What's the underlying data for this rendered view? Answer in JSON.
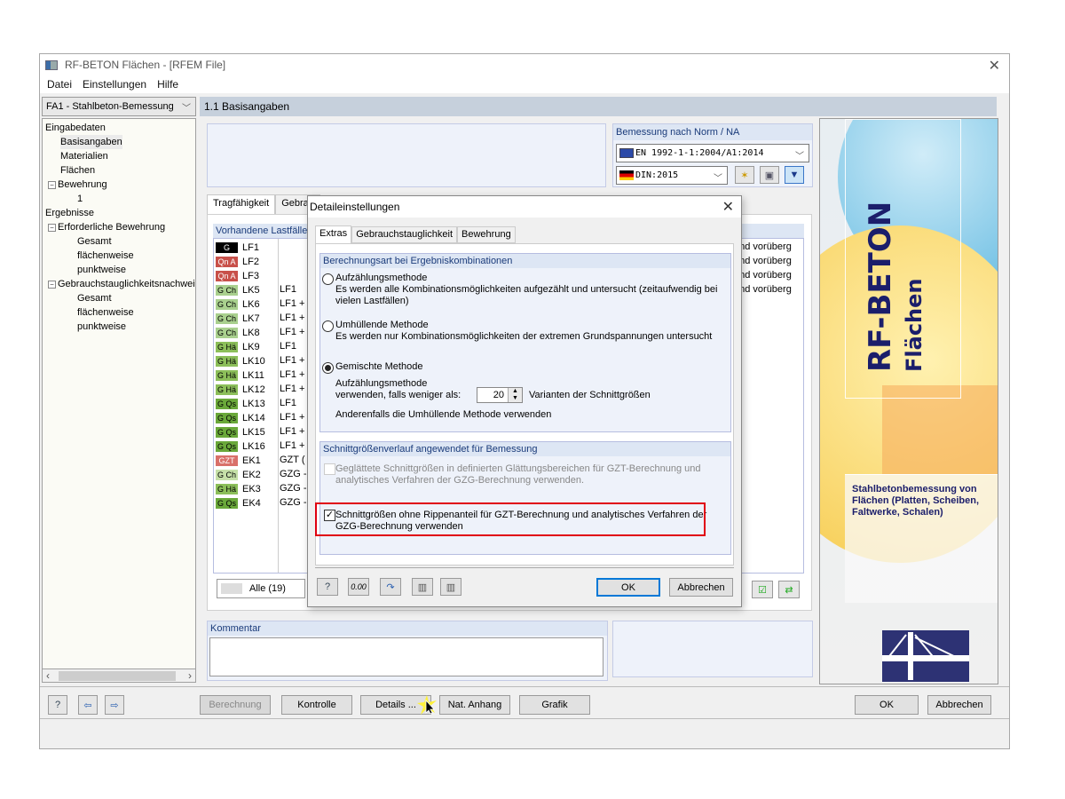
{
  "window": {
    "title": "RF-BETON Flächen - [RFEM File]",
    "menu": [
      "Datei",
      "Einstellungen",
      "Hilfe"
    ]
  },
  "nav": {
    "case_selector": "FA1 - Stahlbeton-Bemessung",
    "tree": [
      {
        "label": "Eingabedaten",
        "level": 0
      },
      {
        "label": "Basisangaben",
        "level": 1,
        "selected": true
      },
      {
        "label": "Materialien",
        "level": 1
      },
      {
        "label": "Flächen",
        "level": 1
      },
      {
        "label": "Bewehrung",
        "level": 1,
        "expander": "−"
      },
      {
        "label": "1",
        "level": 2
      },
      {
        "label": "Ergebnisse",
        "level": 0
      },
      {
        "label": "Erforderliche Bewehrung",
        "level": 1,
        "expander": "−"
      },
      {
        "label": "Gesamt",
        "level": 2
      },
      {
        "label": "flächenweise",
        "level": 2
      },
      {
        "label": "punktweise",
        "level": 2
      },
      {
        "label": "Gebrauchstauglichkeitsnachwei",
        "level": 1,
        "expander": "−"
      },
      {
        "label": "Gesamt",
        "level": 2
      },
      {
        "label": "flächenweise",
        "level": 2
      },
      {
        "label": "punktweise",
        "level": 2
      }
    ]
  },
  "main": {
    "section_title": "1.1 Basisangaben",
    "norm": {
      "header": "Bemessung nach Norm / NA",
      "standard": "EN 1992-1-1:2004/A1:2014",
      "national_annex": "DIN:2015"
    },
    "tabs": [
      "Tragfähigkeit",
      "Gebrau"
    ],
    "loads_header": "Vorhandene Lastfälle",
    "loads": [
      {
        "badge": "G",
        "name": "LF1",
        "desc": "",
        "badge_bg": "#000000",
        "badge_fg": "#ffffff"
      },
      {
        "badge": "Qn A",
        "name": "LF2",
        "desc": "",
        "badge_bg": "#c8504a",
        "badge_fg": "#ffffff"
      },
      {
        "badge": "Qn A",
        "name": "LF3",
        "desc": "",
        "badge_bg": "#c8504a",
        "badge_fg": "#ffffff"
      },
      {
        "badge": "G Ch",
        "name": "LK5",
        "desc": "LF1",
        "badge_bg": "#a9d08e",
        "badge_fg": "#000000"
      },
      {
        "badge": "G Ch",
        "name": "LK6",
        "desc": "LF1 +",
        "badge_bg": "#a9d08e",
        "badge_fg": "#000000"
      },
      {
        "badge": "G Ch",
        "name": "LK7",
        "desc": "LF1 +",
        "badge_bg": "#a9d08e",
        "badge_fg": "#000000"
      },
      {
        "badge": "G Ch",
        "name": "LK8",
        "desc": "LF1 +",
        "badge_bg": "#a9d08e",
        "badge_fg": "#000000"
      },
      {
        "badge": "G Hä",
        "name": "LK9",
        "desc": "LF1",
        "badge_bg": "#8cbf5a",
        "badge_fg": "#000000"
      },
      {
        "badge": "G Hä",
        "name": "LK10",
        "desc": "LF1 +",
        "badge_bg": "#8cbf5a",
        "badge_fg": "#000000"
      },
      {
        "badge": "G Hä",
        "name": "LK11",
        "desc": "LF1 +",
        "badge_bg": "#8cbf5a",
        "badge_fg": "#000000"
      },
      {
        "badge": "G Hä",
        "name": "LK12",
        "desc": "LF1 +",
        "badge_bg": "#8cbf5a",
        "badge_fg": "#000000"
      },
      {
        "badge": "G Qs",
        "name": "LK13",
        "desc": "LF1",
        "badge_bg": "#6aa83a",
        "badge_fg": "#000000"
      },
      {
        "badge": "G Qs",
        "name": "LK14",
        "desc": "LF1 +",
        "badge_bg": "#6aa83a",
        "badge_fg": "#000000"
      },
      {
        "badge": "G Qs",
        "name": "LK15",
        "desc": "LF1 +",
        "badge_bg": "#6aa83a",
        "badge_fg": "#000000"
      },
      {
        "badge": "G Qs",
        "name": "LK16",
        "desc": "LF1 +",
        "badge_bg": "#6aa83a",
        "badge_fg": "#000000"
      },
      {
        "badge": "GZT",
        "name": "EK1",
        "desc": "GZT (",
        "badge_bg": "#d9706a",
        "badge_fg": "#ffffff"
      },
      {
        "badge": "G Ch",
        "name": "EK2",
        "desc": "GZG -",
        "badge_bg": "#c6e0a8",
        "badge_fg": "#000000"
      },
      {
        "badge": "G Hä",
        "name": "EK3",
        "desc": "GZG -",
        "badge_bg": "#8cbf5a",
        "badge_fg": "#000000"
      },
      {
        "badge": "G Qs",
        "name": "EK4",
        "desc": "GZG -",
        "badge_bg": "#6aa83a",
        "badge_fg": "#000000"
      }
    ],
    "right_column_texts": [
      "und vorüberg",
      "und vorüberg",
      "und vorüberg",
      "und vorüberg"
    ],
    "filter_label": "Alle (19)",
    "comment_header": "Kommentar",
    "comment_value": ""
  },
  "banner": {
    "title": "RF-BETON",
    "subtitle": "Flächen",
    "description": "Stahlbetonbemessung von Flächen (Platten, Scheiben, Faltwerke, Schalen)"
  },
  "bottom": {
    "calc": "Berechnung",
    "check": "Kontrolle",
    "details": "Details ...",
    "nat": "Nat. Anhang",
    "graphic": "Grafik",
    "ok": "OK",
    "cancel": "Abbrechen"
  },
  "dialog": {
    "title": "Detaileinstellungen",
    "tabs": [
      "Extras",
      "Gebrauchstauglichkeit",
      "Bewehrung"
    ],
    "group1": {
      "header": "Berechnungsart bei Ergebniskombinationen",
      "options": [
        {
          "label": "Aufzählungsmethode",
          "desc": "Es werden alle Kombinationsmöglichkeiten aufgezählt und untersucht (zeitaufwendig bei vielen Lastfällen)",
          "selected": false
        },
        {
          "label": "Umhüllende Methode",
          "desc": "Es werden nur Kombinationsmöglichkeiten der extremen Grundspannungen untersucht",
          "selected": false
        },
        {
          "label": "Gemischte Methode",
          "desc": "",
          "selected": true
        }
      ],
      "mixed_line1": "Aufzählungsmethode",
      "mixed_line2": "verwenden, falls weniger als:",
      "variants_value": "20",
      "variants_label": "Varianten der Schnittgrößen",
      "otherwise": "Anderenfalls die Umhüllende Methode verwenden"
    },
    "group2": {
      "header": "Schnittgrößenverlauf angewendet für Bemessung",
      "smoothed": {
        "label": "Geglättete Schnittgrößen in definierten Glättungsbereichen für GZT-Berechnung und analytisches Verfahren der GZG-Berechnung verwenden.",
        "checked": false,
        "enabled": false
      },
      "no_ribs": {
        "label": "Schnittgrößen ohne Rippenanteil für GZT-Berechnung und analytisches Verfahren der GZG-Berechnung verwenden",
        "checked": true,
        "enabled": true
      }
    },
    "ok": "OK",
    "cancel": "Abbrechen"
  }
}
